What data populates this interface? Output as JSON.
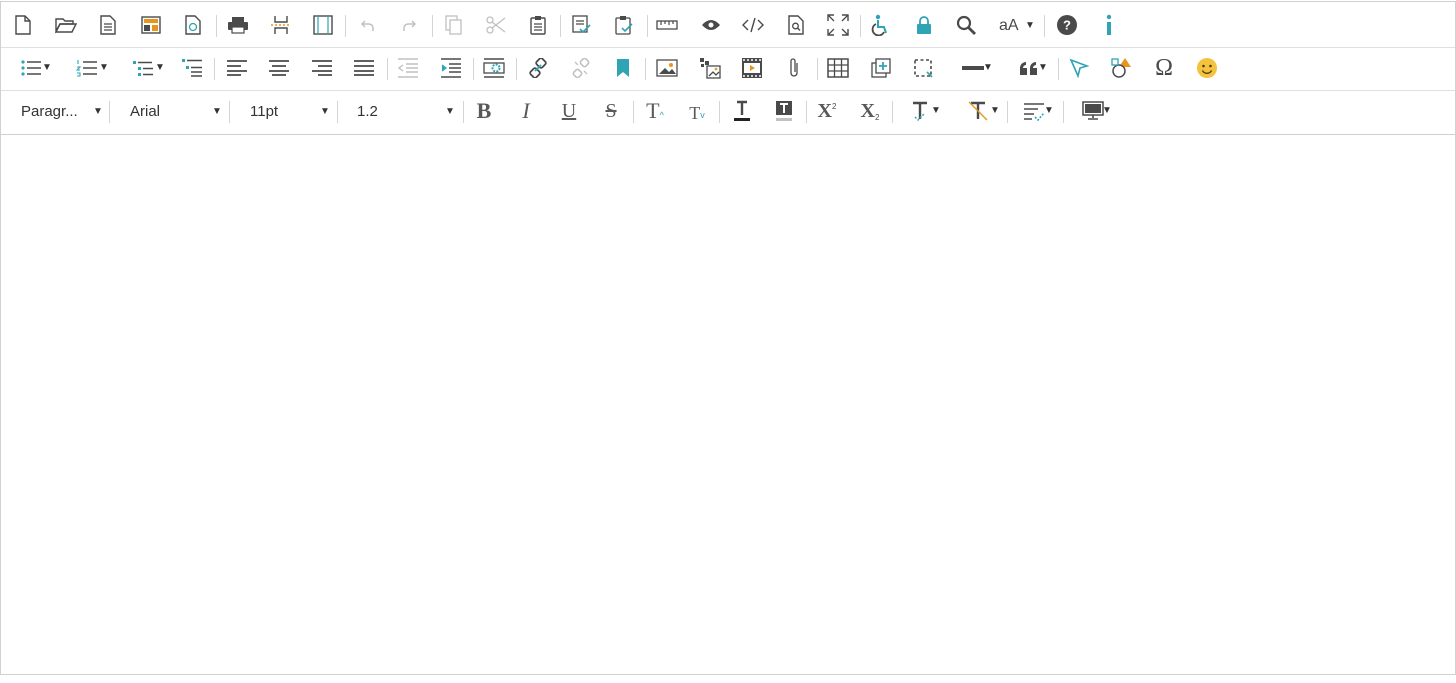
{
  "toolbar_row1": {
    "buttons": [
      "new-document",
      "open",
      "document",
      "template",
      "restore-draft",
      "print",
      "page-break",
      "page-frame",
      "undo",
      "redo",
      "copy",
      "cut",
      "paste",
      "paste-as-text",
      "paste-from-word",
      "ruler",
      "preview",
      "source-code",
      "find-in-page",
      "fullscreen",
      "accessibility",
      "lock",
      "search",
      "font-case",
      "help",
      "info"
    ],
    "font_case_label": "aA"
  },
  "toolbar_row2": {
    "buttons": [
      "bullet-list",
      "numbered-list",
      "multilevel-list",
      "outline-list",
      "align-left",
      "align-center",
      "align-right",
      "justify",
      "outdent",
      "indent",
      "page-settings",
      "link",
      "unlink",
      "bookmark",
      "image",
      "image-gallery",
      "video",
      "attachment",
      "table",
      "insert-frame",
      "select-all",
      "horizontal-rule",
      "blockquote",
      "select-object",
      "shapes",
      "special-character",
      "emoji"
    ]
  },
  "toolbar_row3": {
    "format_label": "Paragr...",
    "font_family_label": "Arial",
    "font_size_label": "11pt",
    "line_height_label": "1.2",
    "bold_glyph": "B",
    "italic_glyph": "I",
    "underline_glyph": "U",
    "strike_glyph": "S",
    "superscript_glyph": "X",
    "subscript_glyph": "X",
    "increase_size_glyph": "T",
    "decrease_size_glyph": "T"
  },
  "colors": {
    "icon": "#4a4a4a",
    "accent_teal": "#2fa4b4",
    "accent_orange": "#e8951f",
    "disabled": "#c0c0c0",
    "emoji": "#f5c23e"
  }
}
